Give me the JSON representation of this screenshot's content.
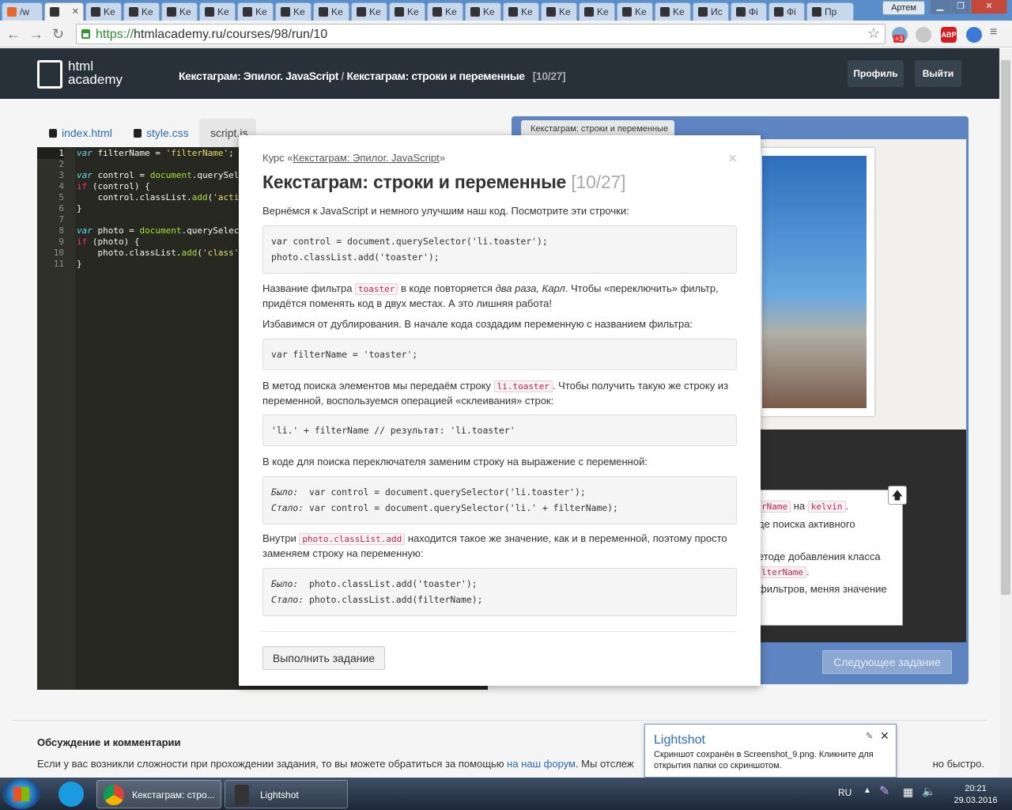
{
  "browser": {
    "tabs": [
      {
        "label": "/w",
        "active": false
      },
      {
        "label": "",
        "active": true
      },
      {
        "label": "Ke"
      },
      {
        "label": "Ke"
      },
      {
        "label": "Ke"
      },
      {
        "label": "Ke"
      },
      {
        "label": "Ke"
      },
      {
        "label": "Ke"
      },
      {
        "label": "Ke"
      },
      {
        "label": "Ke"
      },
      {
        "label": "Ke"
      },
      {
        "label": "Ke"
      },
      {
        "label": "Ke"
      },
      {
        "label": "Ke"
      },
      {
        "label": "Ke"
      },
      {
        "label": "Ke"
      },
      {
        "label": "Ke"
      },
      {
        "label": "Ke"
      },
      {
        "label": "Ис"
      },
      {
        "label": "Фі"
      },
      {
        "label": "Фі"
      },
      {
        "label": "Пр"
      }
    ],
    "user_label": "Артем",
    "url_scheme": "https://",
    "url_rest": "htmlacademy.ru/courses/98/run/10",
    "ext_badge": "+3",
    "abp_label": "ABP"
  },
  "site": {
    "logo_line1": "html",
    "logo_line2": "academy",
    "breadcrumb_course": "Кекстаграм: Эпилог. JavaScript",
    "breadcrumb_sep": " / ",
    "breadcrumb_task": "Кекстаграм: строки и переменные",
    "breadcrumb_count": "[10/27]",
    "profile_label": "Профиль",
    "logout_label": "Выйти"
  },
  "editor": {
    "tabs": [
      "index.html",
      "style.css",
      "script.js"
    ],
    "line_numbers": [
      "1",
      "2",
      "3",
      "4",
      "5",
      "6",
      "7",
      "8",
      "9",
      "10",
      "11"
    ]
  },
  "preview": {
    "tab_label": "Кекстаграм: строки и переменные",
    "tip_line1_pre": "rName",
    "tip_line1_mid": "на",
    "tip_line1_code": "kelvin",
    "tip_line2": "де поиска активного",
    "tip_line3": "етоде добавления класса",
    "tip_line3_code": "lterName",
    "tip_line4": "фильтров, меняя значение",
    "next_label": "Следующее задание"
  },
  "modal": {
    "course_prefix": "Курс «",
    "course_link": "Кекстаграм: Эпилог. JavaScript",
    "course_suffix": "»",
    "title": "Кекстаграм: строки и переменные",
    "title_count": "[10/27]",
    "p1": "Вернёмся к JavaScript и немного улучшим наш код. Посмотрите эти строчки:",
    "code1_l1": "var control = document.querySelector('li.toaster');",
    "code1_l2": "photo.classList.add('toaster');",
    "p2_a": "Название фильтра ",
    "p2_code": "toaster",
    "p2_b": " в коде повторяется ",
    "p2_em": "два раза, Карл",
    "p2_c": ". Чтобы «переключить» фильтр,",
    "p2_line2": "придётся поменять код в двух местах. А это лишняя работа!",
    "p3": "Избавимся от дублирования. В начале кода создадим переменную с названием фильтра:",
    "code2": "var filterName = 'toaster';",
    "p4_a": "В метод поиска элементов мы передаём строку ",
    "p4_code": "li.toaster",
    "p4_b": ". Чтобы получить такую же строку из",
    "p4_line2": "переменной, воспользуемся операцией «склеивания» строк:",
    "code3": "'li.' + filterName // результат: 'li.toaster'",
    "p5": "В коде для поиска переключателя заменим строку на выражение с переменной:",
    "code4_lbl1": "Было:",
    "code4_l1": "var control = document.querySelector('li.toaster');",
    "code4_lbl2": "Стало:",
    "code4_l2": "var control = document.querySelector('li.' + filterName);",
    "p6_a": "Внутри ",
    "p6_code": "photo.classList.add",
    "p6_b": " находится такое же значение, как и в переменной, поэтому просто",
    "p6_line2": "заменяем строку на переменную:",
    "code5_lbl1": "Было:",
    "code5_l1": "photo.classList.add('toaster');",
    "code5_lbl2": "Стало:",
    "code5_l2": "photo.classList.add(filterName);",
    "close_label": "×",
    "run_label": "Выполнить задание"
  },
  "discussion": {
    "title": "Обсуждение и комментарии",
    "text_a": "Если у вас возникли сложности при прохождении задания, то вы можете обратиться за помощью ",
    "link": "на наш форум",
    "text_b": ". Мы отслеж",
    "text_c": "но быстро."
  },
  "lightshot": {
    "title": "Lightshot",
    "message": "Скриншот сохранён в Screenshot_9.png. Кликните для открытия папки со скриншотом."
  },
  "taskbar": {
    "chrome_label": "Кекстаграм: стро...",
    "lightshot_label": "Lightshot",
    "lang": "RU",
    "time": "20:21",
    "date": "29.03.2016"
  },
  "colors": {
    "header_bg": "#283039",
    "preview_bg": "#5e84c2",
    "editor_bg": "#272822",
    "link": "#2a6ab0"
  }
}
